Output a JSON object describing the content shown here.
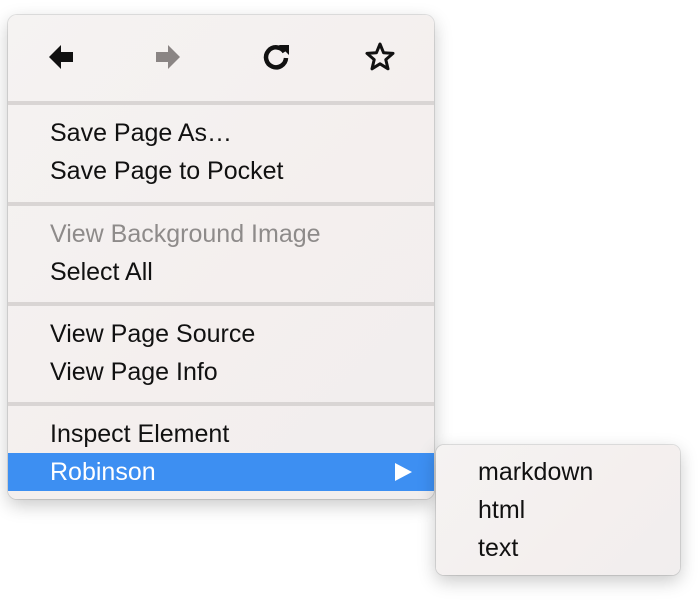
{
  "toolbar": {
    "buttons": [
      {
        "name": "back",
        "icon": "arrow-left-icon",
        "enabled": true
      },
      {
        "name": "forward",
        "icon": "arrow-right-icon",
        "enabled": false
      },
      {
        "name": "reload",
        "icon": "reload-icon",
        "enabled": true
      },
      {
        "name": "bookmark",
        "icon": "star-icon",
        "enabled": true
      }
    ]
  },
  "menu": {
    "groups": [
      {
        "items": [
          {
            "label": "Save Page As…",
            "disabled": false
          },
          {
            "label": "Save Page to Pocket",
            "disabled": false
          }
        ]
      },
      {
        "items": [
          {
            "label": "View Background Image",
            "disabled": true
          },
          {
            "label": "Select All",
            "disabled": false
          }
        ]
      },
      {
        "items": [
          {
            "label": "View Page Source",
            "disabled": false
          },
          {
            "label": "View Page Info",
            "disabled": false
          }
        ]
      },
      {
        "items": [
          {
            "label": "Inspect Element",
            "disabled": false
          },
          {
            "label": "Robinson",
            "disabled": false,
            "highlighted": true,
            "has_submenu": true
          }
        ]
      }
    ]
  },
  "submenu": {
    "items": [
      {
        "label": "markdown"
      },
      {
        "label": "html"
      },
      {
        "label": "text"
      }
    ]
  },
  "colors": {
    "highlight": "#3d8ff2",
    "disabled_text": "#8e8b8a",
    "enabled_icon": "#111111",
    "disabled_icon": "#8a8584"
  }
}
